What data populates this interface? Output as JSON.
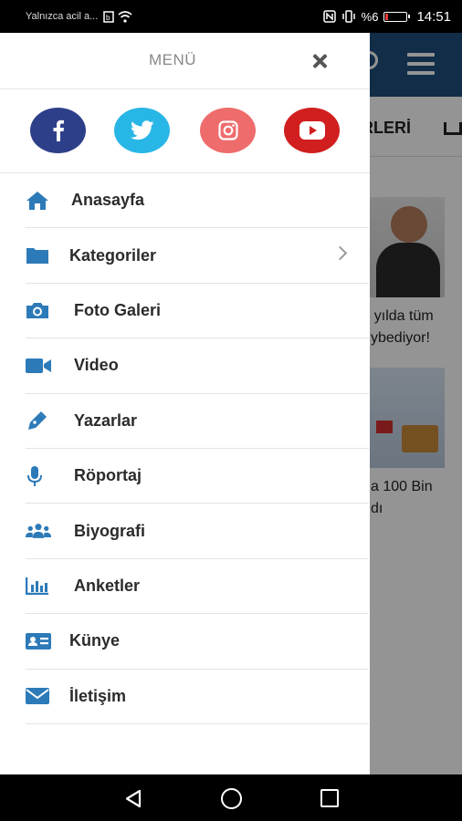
{
  "status_bar": {
    "notification": "Yalnızca acil a...",
    "battery_percent": "%6",
    "time": "14:51"
  },
  "background_app": {
    "nav_text": "RLERİ",
    "card1_line1": "- yılda tüm",
    "card1_line2": "ybediyor!",
    "card2_line1": "a 100 Bin",
    "card2_line2": "dı"
  },
  "drawer": {
    "title": "MENÜ",
    "close_icon": "close-icon",
    "social": [
      {
        "name": "facebook",
        "color": "#2e3f8a"
      },
      {
        "name": "twitter",
        "color": "#28b6e6"
      },
      {
        "name": "instagram",
        "color": "#ef6c6c"
      },
      {
        "name": "youtube",
        "color": "#d11f1f"
      }
    ],
    "icon_color": "#2d7ab8",
    "items": [
      {
        "label": "Anasayfa",
        "icon": "home-icon"
      },
      {
        "label": "Kategoriler",
        "icon": "folder-icon",
        "has_submenu": true
      },
      {
        "label": "Foto Galeri",
        "icon": "camera-icon"
      },
      {
        "label": "Video",
        "icon": "video-camera-icon"
      },
      {
        "label": "Yazarlar",
        "icon": "pen-icon"
      },
      {
        "label": "Röportaj",
        "icon": "microphone-icon"
      },
      {
        "label": "Biyografi",
        "icon": "users-icon"
      },
      {
        "label": "Anketler",
        "icon": "bar-chart-icon"
      },
      {
        "label": "Künye",
        "icon": "id-card-icon"
      },
      {
        "label": "İletişim",
        "icon": "envelope-icon"
      }
    ]
  },
  "nav_bar": {
    "back": "back-icon",
    "home": "home-circle-icon",
    "recent": "recent-apps-icon"
  }
}
